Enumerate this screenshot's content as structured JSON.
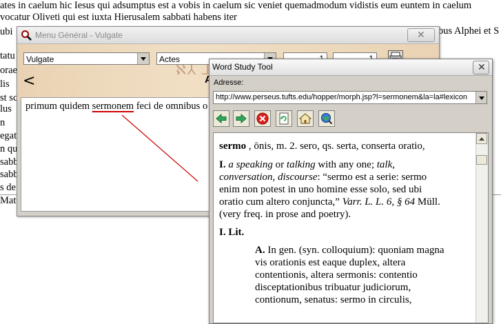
{
  "background_text": {
    "lines": [
      "ates in caelum hic Iesus qui adsumptus est a vobis in caelum sic veniet quemadmodum vidistis eum euntem in caelum",
      "vocatur Oliveti qui est iuxta Hierusalem sabbati habens iter",
      "ubi",
      "tatu",
      "orae",
      "lis",
      "st sc",
      "lus",
      "n",
      "egat",
      "n qu",
      "sabb",
      "sabb",
      "s de",
      "Matt"
    ],
    "right_fragment": "bus Alphei et S"
  },
  "menu_window": {
    "title": "Menu Général - Vulgate",
    "close_glyph": "✕",
    "version_select": "Vulgate",
    "book_select": "Actes",
    "chapter": "1",
    "verse": "1",
    "back_glyph": "<",
    "letter": "A",
    "verse_text_before": "primum quidem ",
    "verse_text_highlight": "sermonem",
    "verse_text_after": " feci de omnibus o"
  },
  "word_study": {
    "title": "Word Study Tool",
    "close_glyph": "✕",
    "address_label": "Adresse:",
    "address_value": "http://www.perseus.tufts.edu/hopper/morph.jsp?l=sermonem&la=la#lexicon",
    "toolbar": [
      "back-arrow-icon",
      "forward-arrow-icon",
      "stop-icon",
      "refresh-icon",
      "home-icon",
      "globe-search-icon"
    ],
    "entry": {
      "headword": "sermo",
      "head_rest": " , ōnis, m. 2. sero, qs. serta, conserta oratio,",
      "l1_roman": "I.",
      "l1_i1": "a speaking",
      "l1_or": " or ",
      "l1_i2": "talking",
      "l1_rest": " with any one; ",
      "l1_i3": "talk,",
      "l2_i": "conversation, discourse",
      "l2_rest": ": “sermo est a serie: sermo",
      "l3": "enim non potest in uno homine esse solo, sed ubi",
      "l4_a": "oratio cum altero conjuncta,” ",
      "l4_i": "Varr. L. L. 6, § 64",
      "l4_b": " Müll.",
      "l5": "(very freq. in prose and poetry).",
      "section": "I. Lit.",
      "sub_letter": "A.",
      "s1": " In gen. (syn. colloquium): quoniam magna",
      "s2": "vis orationis est eaque duplex, altera",
      "s3": "contentionis, altera sermonis: contentio",
      "s4": "disceptationibus tribuatur judiciorum,",
      "s5": "contionum, senatus: sermo in circulis,"
    }
  }
}
